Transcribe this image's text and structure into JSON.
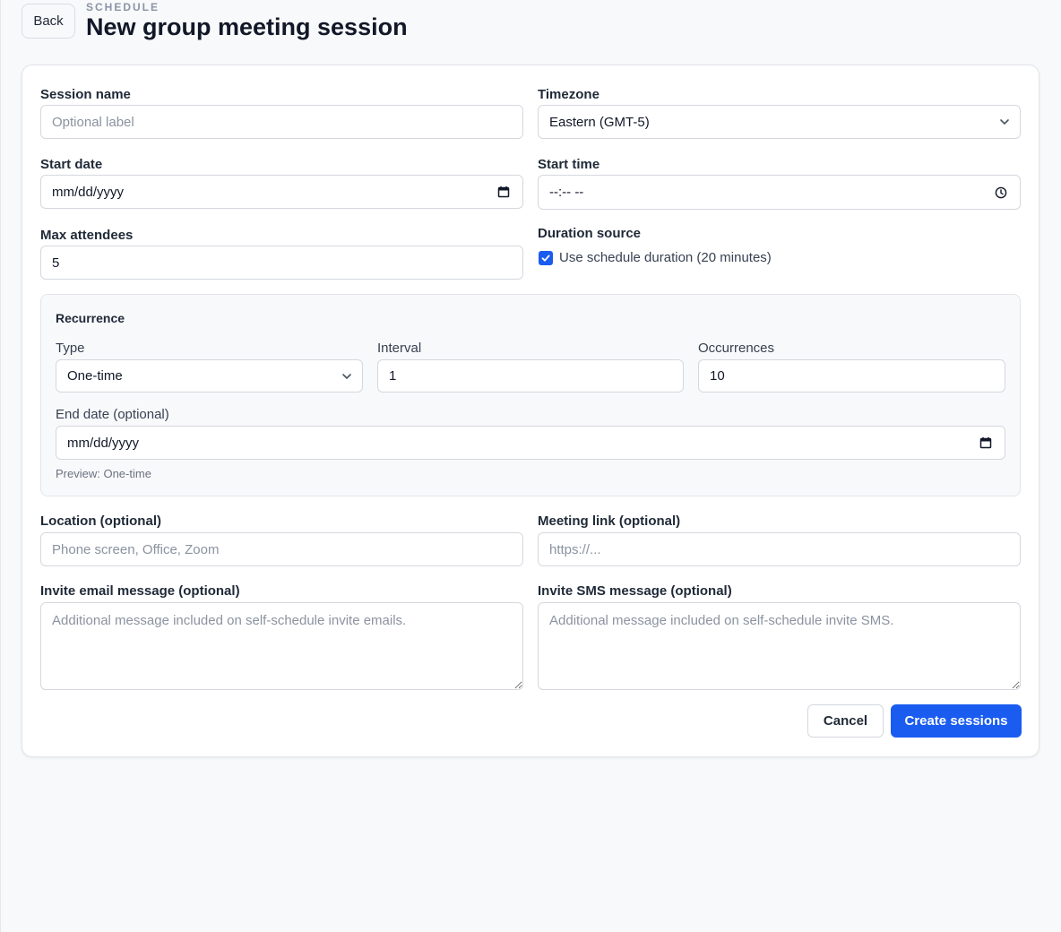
{
  "header": {
    "back_label": "Back",
    "eyebrow": "SCHEDULE",
    "title": "New group meeting session"
  },
  "form": {
    "session_name": {
      "label": "Session name",
      "value": "",
      "placeholder": "Optional label"
    },
    "timezone": {
      "label": "Timezone",
      "selected": "Eastern (GMT-5)"
    },
    "start_date": {
      "label": "Start date",
      "display": "mm/dd/yyyy"
    },
    "start_time": {
      "label": "Start time",
      "display": "--:-- --"
    },
    "max_attendees": {
      "label": "Max attendees",
      "value": "5"
    },
    "duration_source": {
      "label": "Duration source",
      "checkbox_label": "Use schedule duration (20 minutes)",
      "checked": true
    },
    "recurrence": {
      "title": "Recurrence",
      "type": {
        "label": "Type",
        "selected": "One-time"
      },
      "interval": {
        "label": "Interval",
        "value": "1"
      },
      "occurrences": {
        "label": "Occurrences",
        "value": "10"
      },
      "end_date": {
        "label": "End date (optional)",
        "display": "mm/dd/yyyy"
      },
      "preview": "Preview: One-time"
    },
    "location": {
      "label": "Location (optional)",
      "value": "",
      "placeholder": "Phone screen, Office, Zoom"
    },
    "meeting_link": {
      "label": "Meeting link (optional)",
      "value": "",
      "placeholder": "https://..."
    },
    "invite_email": {
      "label": "Invite email message (optional)",
      "value": "",
      "placeholder": "Additional message included on self-schedule invite emails."
    },
    "invite_sms": {
      "label": "Invite SMS message (optional)",
      "value": "",
      "placeholder": "Additional message included on self-schedule invite SMS."
    }
  },
  "actions": {
    "cancel_label": "Cancel",
    "create_label": "Create sessions"
  },
  "colors": {
    "primary": "#1a5cf0",
    "background": "#f8f9fb",
    "card": "#ffffff",
    "border": "#d4d8de"
  },
  "icons": [
    "chevron-down-icon",
    "calendar-icon",
    "clock-icon",
    "checkmark-icon"
  ]
}
